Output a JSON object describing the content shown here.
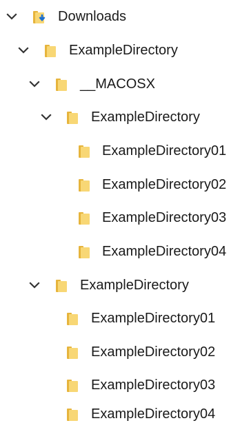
{
  "tree": {
    "downloads": {
      "label": "Downloads",
      "icon": "downloads-folder-icon",
      "expanded": true
    },
    "example_directory_top": {
      "label": "ExampleDirectory",
      "icon": "folder-icon",
      "expanded": true
    },
    "macosx": {
      "label": "__MACOSX",
      "icon": "folder-icon",
      "expanded": true
    },
    "macosx_example_directory": {
      "label": "ExampleDirectory",
      "icon": "folder-icon",
      "expanded": true
    },
    "macosx_children": [
      {
        "label": "ExampleDirectory01",
        "icon": "folder-icon"
      },
      {
        "label": "ExampleDirectory02",
        "icon": "folder-icon"
      },
      {
        "label": "ExampleDirectory03",
        "icon": "folder-icon"
      },
      {
        "label": "ExampleDirectory04",
        "icon": "folder-icon"
      }
    ],
    "example_directory_inner": {
      "label": "ExampleDirectory",
      "icon": "folder-icon",
      "expanded": true
    },
    "inner_children": [
      {
        "label": "ExampleDirectory01",
        "icon": "folder-icon"
      },
      {
        "label": "ExampleDirectory02",
        "icon": "folder-icon"
      },
      {
        "label": "ExampleDirectory03",
        "icon": "folder-icon"
      },
      {
        "label": "ExampleDirectory04",
        "icon": "folder-icon"
      }
    ]
  },
  "colors": {
    "folder_body": "#f8d775",
    "folder_tab": "#e6b43c",
    "download_arrow": "#1b6fd1",
    "chevron": "#333333",
    "text": "#1a1a1a"
  }
}
